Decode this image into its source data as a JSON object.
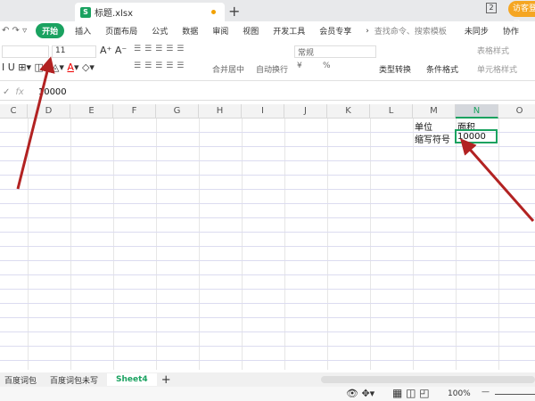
{
  "titlebar": {
    "file_tab": "标题.xlsx",
    "new_tab": "+",
    "badge": "2",
    "visitor": "访客登录"
  },
  "menu": {
    "items": [
      "开始",
      "插入",
      "页面布局",
      "公式",
      "数据",
      "审阅",
      "视图",
      "开发工具",
      "会员专享"
    ],
    "more": "›",
    "search": "查找命令、搜索模板",
    "sync": "未同步",
    "collab": "协作"
  },
  "ribbon": {
    "font_size": "11",
    "merge": "合并居中",
    "wrap": "自动换行",
    "format": "常规",
    "convert": "类型转换",
    "cond_format": "条件格式",
    "table_style": "表格样式",
    "cell_style": "单元格样式",
    "percent": "%",
    "currency": "¥"
  },
  "formula_bar": {
    "fx": "fx",
    "value": "10000"
  },
  "columns": [
    "C",
    "D",
    "E",
    "F",
    "G",
    "H",
    "I",
    "J",
    "K",
    "L",
    "M",
    "N",
    "O"
  ],
  "cells": {
    "M1": "单位",
    "N1": "面积",
    "M2": "缩写符号",
    "N2": "10000"
  },
  "sheets": {
    "tabs": [
      "百度词包",
      "百度词包未写",
      "Sheet4"
    ],
    "active": "Sheet4",
    "add": "+"
  },
  "status": {
    "zoom": "100%"
  },
  "colors": {
    "accent": "#1aa260",
    "arrow": "#b22222"
  }
}
